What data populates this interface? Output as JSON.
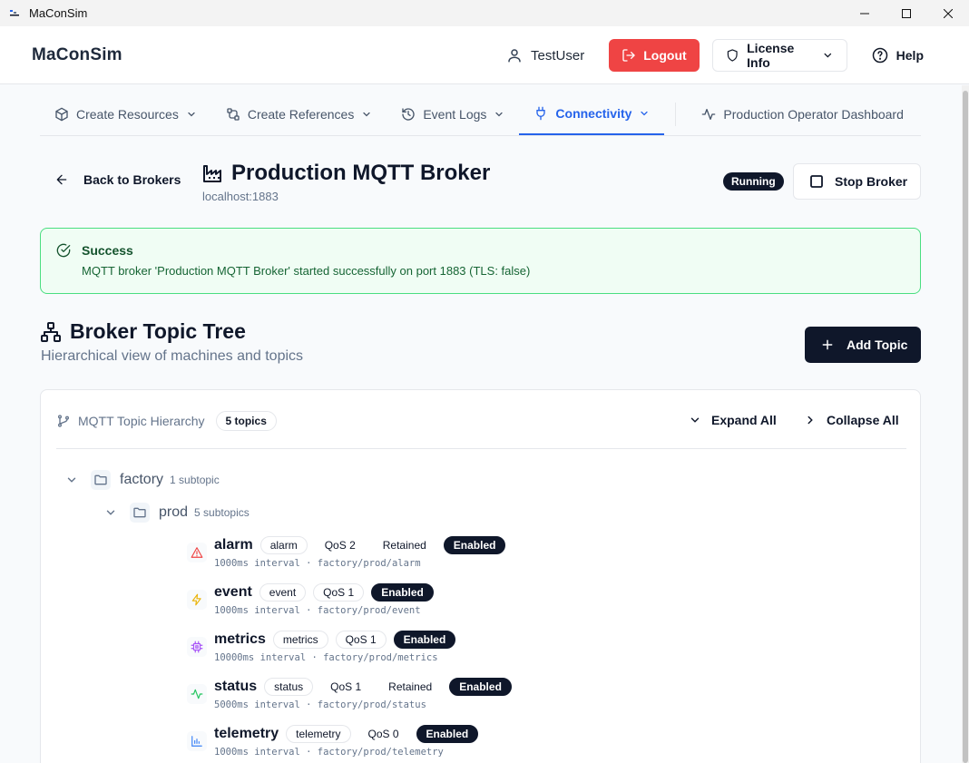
{
  "window": {
    "title": "MaConSim"
  },
  "header": {
    "brand": "MaConSim",
    "user": "TestUser",
    "logout_label": "Logout",
    "license_label": "License Info",
    "help_label": "Help"
  },
  "tabs": [
    {
      "label": "Create Resources",
      "icon": "cube-icon"
    },
    {
      "label": "Create References",
      "icon": "link-icon"
    },
    {
      "label": "Event Logs",
      "icon": "history-icon"
    },
    {
      "label": "Connectivity",
      "icon": "plug-icon",
      "active": true
    },
    {
      "label": "Production Operator Dashboard",
      "icon": "activity-icon"
    }
  ],
  "page": {
    "back_label": "Back to Brokers",
    "title": "Production MQTT Broker",
    "subtitle": "localhost:1883",
    "status": "Running",
    "stop_label": "Stop Broker"
  },
  "alert": {
    "title": "Success",
    "message": "MQTT broker 'Production MQTT Broker' started successfully on port 1883 (TLS: false)"
  },
  "section": {
    "title": "Broker Topic Tree",
    "subtitle": "Hierarchical view of machines and topics",
    "add_label": "Add Topic"
  },
  "tree": {
    "heading": "MQTT Topic Hierarchy",
    "count": "5 topics",
    "expand_label": "Expand All",
    "collapse_label": "Collapse All",
    "root": {
      "name": "factory",
      "sub": "1 subtopic"
    },
    "child": {
      "name": "prod",
      "sub": "5 subtopics"
    },
    "topics": [
      {
        "name": "alarm",
        "type": "alarm",
        "qos": "QoS 2",
        "retained": "Retained",
        "enabled": "Enabled",
        "meta": "1000ms interval · factory/prod/alarm",
        "icon": "alert-triangle-icon",
        "icon_color": "#ef4444"
      },
      {
        "name": "event",
        "type": "event",
        "qos": "QoS 1",
        "retained": "",
        "enabled": "Enabled",
        "meta": "1000ms interval · factory/prod/event",
        "icon": "zap-icon",
        "icon_color": "#eab308"
      },
      {
        "name": "metrics",
        "type": "metrics",
        "qos": "QoS 1",
        "retained": "",
        "enabled": "Enabled",
        "meta": "10000ms interval · factory/prod/metrics",
        "icon": "cpu-icon",
        "icon_color": "#a855f7"
      },
      {
        "name": "status",
        "type": "status",
        "qos": "QoS 1",
        "retained": "Retained",
        "enabled": "Enabled",
        "meta": "5000ms interval · factory/prod/status",
        "icon": "activity-icon",
        "icon_color": "#22c55e"
      },
      {
        "name": "telemetry",
        "type": "telemetry",
        "qos": "QoS 0",
        "retained": "",
        "enabled": "Enabled",
        "meta": "1000ms interval · factory/prod/telemetry",
        "icon": "bar-chart-icon",
        "icon_color": "#3b82f6"
      }
    ]
  },
  "colors": {
    "primary": "#0f172a",
    "accent": "#2563eb",
    "danger": "#ef4444",
    "success_bg": "#f0fdf4",
    "success_border": "#4ade80"
  }
}
